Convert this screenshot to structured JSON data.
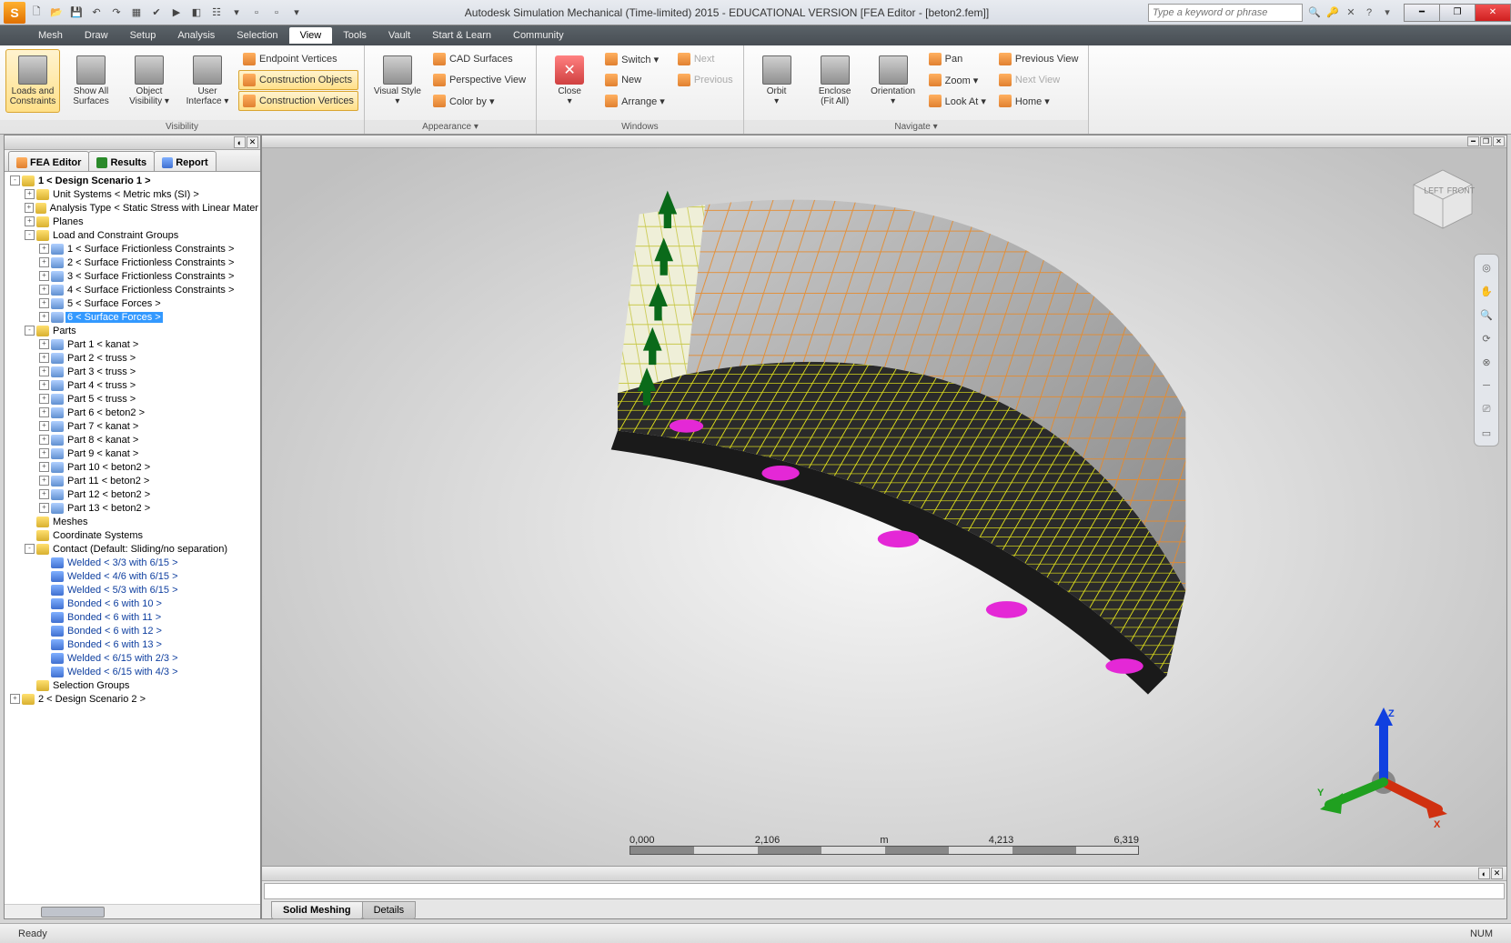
{
  "title": "Autodesk Simulation Mechanical (Time-limited) 2015 - EDUCATIONAL VERSION     [FEA Editor - [beton2.fem]]",
  "searchPlaceholder": "Type a keyword or phrase",
  "menus": [
    "Mesh",
    "Draw",
    "Setup",
    "Analysis",
    "Selection",
    "View",
    "Tools",
    "Vault",
    "Start & Learn",
    "Community"
  ],
  "activeMenu": "View",
  "ribbon": {
    "groups": [
      {
        "label": "Visibility",
        "big": [
          {
            "k": "loads",
            "l1": "Loads and",
            "l2": "Constraints",
            "active": true
          },
          {
            "k": "showall",
            "l1": "Show All",
            "l2": "Surfaces"
          },
          {
            "k": "objvis",
            "l1": "Object",
            "l2": "Visibility ▾"
          },
          {
            "k": "ui",
            "l1": "User",
            "l2": "Interface ▾"
          }
        ],
        "col": [
          {
            "k": "epverts",
            "l": "Endpoint Vertices"
          },
          {
            "k": "cobj",
            "l": "Construction Objects",
            "active": true
          },
          {
            "k": "cverts",
            "l": "Construction Vertices",
            "active": true
          }
        ]
      },
      {
        "label": "Appearance ▾",
        "big": [
          {
            "k": "vstyle",
            "l1": "Visual Style",
            "l2": "▾"
          }
        ],
        "col": [
          {
            "k": "cadsurf",
            "l": "CAD Surfaces"
          },
          {
            "k": "persp",
            "l": "Perspective View"
          },
          {
            "k": "colorby",
            "l": "Color by ▾"
          }
        ]
      },
      {
        "label": "Windows",
        "big": [
          {
            "k": "close",
            "l1": "Close",
            "l2": "▾"
          }
        ],
        "col": [
          {
            "k": "switch",
            "l": "Switch ▾"
          },
          {
            "k": "new",
            "l": "New"
          },
          {
            "k": "arrange",
            "l": "Arrange ▾"
          }
        ],
        "col2": [
          {
            "k": "next",
            "l": "Next",
            "disabled": true
          },
          {
            "k": "prev",
            "l": "Previous",
            "disabled": true
          }
        ]
      },
      {
        "label": "Navigate ▾",
        "big": [
          {
            "k": "orbit",
            "l1": "Orbit",
            "l2": "▾"
          },
          {
            "k": "enclose",
            "l1": "Enclose",
            "l2": "(Fit All)"
          },
          {
            "k": "orient",
            "l1": "Orientation",
            "l2": "▾"
          }
        ],
        "col": [
          {
            "k": "pan",
            "l": "Pan"
          },
          {
            "k": "zoom",
            "l": "Zoom ▾"
          },
          {
            "k": "lookat",
            "l": "Look At ▾"
          }
        ],
        "col2": [
          {
            "k": "prevview",
            "l": "Previous View"
          },
          {
            "k": "nextview",
            "l": "Next View",
            "disabled": true
          },
          {
            "k": "home",
            "l": "Home ▾"
          }
        ]
      }
    ]
  },
  "sideTabs": [
    {
      "k": "fea",
      "l": "FEA Editor"
    },
    {
      "k": "res",
      "l": "Results"
    },
    {
      "k": "rep",
      "l": "Report"
    }
  ],
  "tree": [
    {
      "d": 0,
      "e": "-",
      "l": "1 < Design Scenario 1 >",
      "bold": true
    },
    {
      "d": 1,
      "e": "+",
      "l": "Unit Systems < Metric mks (SI) >"
    },
    {
      "d": 1,
      "e": "+",
      "l": "Analysis Type < Static Stress with Linear Mater"
    },
    {
      "d": 1,
      "e": "+",
      "l": "Planes"
    },
    {
      "d": 1,
      "e": "-",
      "l": "Load and Constraint Groups"
    },
    {
      "d": 2,
      "e": "+",
      "l": "1 < Surface Frictionless Constraints >"
    },
    {
      "d": 2,
      "e": "+",
      "l": "2 < Surface Frictionless Constraints >"
    },
    {
      "d": 2,
      "e": "+",
      "l": "3 < Surface Frictionless Constraints >"
    },
    {
      "d": 2,
      "e": "+",
      "l": "4 < Surface Frictionless Constraints >"
    },
    {
      "d": 2,
      "e": "+",
      "l": "5 < Surface Forces >"
    },
    {
      "d": 2,
      "e": "+",
      "l": "6 < Surface Forces >",
      "sel": true
    },
    {
      "d": 1,
      "e": "-",
      "l": "Parts"
    },
    {
      "d": 2,
      "e": "+",
      "l": "Part 1 < kanat >"
    },
    {
      "d": 2,
      "e": "+",
      "l": "Part 2 < truss >"
    },
    {
      "d": 2,
      "e": "+",
      "l": "Part 3 < truss >"
    },
    {
      "d": 2,
      "e": "+",
      "l": "Part 4 < truss >"
    },
    {
      "d": 2,
      "e": "+",
      "l": "Part 5 < truss >"
    },
    {
      "d": 2,
      "e": "+",
      "l": "Part 6 < beton2 >"
    },
    {
      "d": 2,
      "e": "+",
      "l": "Part 7 < kanat >"
    },
    {
      "d": 2,
      "e": "+",
      "l": "Part 8 < kanat >"
    },
    {
      "d": 2,
      "e": "+",
      "l": "Part 9 < kanat >"
    },
    {
      "d": 2,
      "e": "+",
      "l": "Part 10 < beton2 >"
    },
    {
      "d": 2,
      "e": "+",
      "l": "Part 11 < beton2 >"
    },
    {
      "d": 2,
      "e": "+",
      "l": "Part 12 < beton2 >"
    },
    {
      "d": 2,
      "e": "+",
      "l": "Part 13 < beton2 >"
    },
    {
      "d": 1,
      "e": " ",
      "l": "Meshes"
    },
    {
      "d": 1,
      "e": " ",
      "l": "Coordinate Systems"
    },
    {
      "d": 1,
      "e": "-",
      "l": "Contact (Default: Sliding/no separation)"
    },
    {
      "d": 2,
      "e": " ",
      "l": "Welded < 3/3 with 6/15 >",
      "blue": true
    },
    {
      "d": 2,
      "e": " ",
      "l": "Welded < 4/6 with 6/15 >",
      "blue": true
    },
    {
      "d": 2,
      "e": " ",
      "l": "Welded < 5/3 with 6/15 >",
      "blue": true
    },
    {
      "d": 2,
      "e": " ",
      "l": "Bonded < 6 with 10 >",
      "blue": true
    },
    {
      "d": 2,
      "e": " ",
      "l": "Bonded < 6 with 11 >",
      "blue": true
    },
    {
      "d": 2,
      "e": " ",
      "l": "Bonded < 6 with 12 >",
      "blue": true
    },
    {
      "d": 2,
      "e": " ",
      "l": "Bonded < 6 with 13 >",
      "blue": true
    },
    {
      "d": 2,
      "e": " ",
      "l": "Welded < 6/15 with 2/3 >",
      "blue": true
    },
    {
      "d": 2,
      "e": " ",
      "l": "Welded < 6/15 with 4/3 >",
      "blue": true
    },
    {
      "d": 1,
      "e": " ",
      "l": "Selection Groups"
    },
    {
      "d": 0,
      "e": "+",
      "l": "2 < Design Scenario 2 >"
    }
  ],
  "scale": {
    "t0": "0,000",
    "t1": "2,106",
    "tm": "m",
    "t2": "4,213",
    "t3": "6,319"
  },
  "triad": {
    "x": "X",
    "y": "Y",
    "z": "Z"
  },
  "bottomTabs": [
    {
      "k": "solid",
      "l": "Solid Meshing",
      "a": true
    },
    {
      "k": "det",
      "l": "Details"
    }
  ],
  "status": {
    "left": "Ready",
    "right": "NUM"
  }
}
